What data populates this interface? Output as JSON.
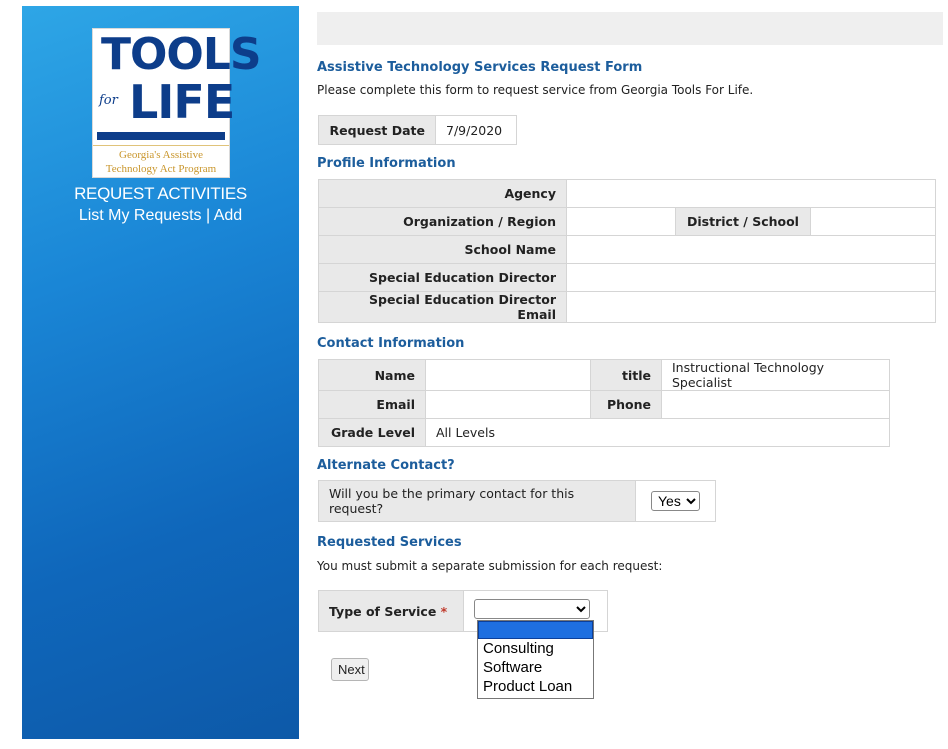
{
  "sidebar": {
    "logo_tools": "TOOLS",
    "logo_for": "for",
    "logo_life": "LIFE",
    "logo_tag_line1": "Georgia's Assistive",
    "logo_tag_line2": "Technology Act Program",
    "nav_title": "REQUEST ACTIVITIES",
    "link_list": "List My Requests",
    "link_sep": "|",
    "link_add": "Add"
  },
  "form": {
    "title": "Assistive Technology Services Request Form",
    "intro": "Please complete this form to request service from Georgia Tools For Life.",
    "request_date_label": "Request Date",
    "request_date_value": "7/9/2020"
  },
  "profile": {
    "title": "Profile Information",
    "agency_label": "Agency",
    "agency_value": "",
    "org_region_label": "Organization / Region",
    "org_region_value": "",
    "district_label": "District / School",
    "district_value": "",
    "school_name_label": "School Name",
    "school_name_value": "",
    "sped_director_label": "Special Education Director",
    "sped_director_value": "",
    "sped_email_label": "Special Education Director Email",
    "sped_email_value": ""
  },
  "contact": {
    "title": "Contact Information",
    "name_label": "Name",
    "name_value": "",
    "title_label": "title",
    "title_value": "Instructional Technology Specialist",
    "email_label": "Email",
    "email_value": "",
    "phone_label": "Phone",
    "phone_value": "",
    "grade_label": "Grade Level",
    "grade_value": "All Levels"
  },
  "alternate": {
    "title": "Alternate Contact?",
    "question": "Will you be the primary contact for this request?",
    "selected": "Yes"
  },
  "services": {
    "title": "Requested Services",
    "note": "You must submit a separate submission for each request:",
    "type_label": "Type of Service",
    "required_mark": "*",
    "options": [
      "",
      "Consulting",
      "Software",
      "Product Loan"
    ]
  },
  "buttons": {
    "next": "Next"
  }
}
